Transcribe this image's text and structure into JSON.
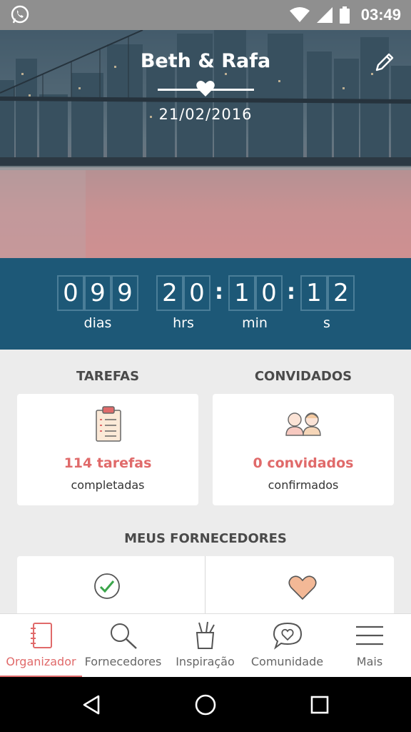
{
  "status_bar": {
    "time": "03:49"
  },
  "hero": {
    "couple": "Beth & Rafa",
    "date": "21/02/2016"
  },
  "countdown": {
    "days": [
      "0",
      "9",
      "9"
    ],
    "hours": [
      "2",
      "0"
    ],
    "minutes": [
      "1",
      "0"
    ],
    "seconds": [
      "1",
      "2"
    ],
    "units": {
      "days": "dias",
      "hours": "hrs",
      "minutes": "min",
      "seconds": "s"
    }
  },
  "tasks": {
    "title": "TAREFAS",
    "count": "114 tarefas",
    "sub": "completadas"
  },
  "guests": {
    "title": "CONVIDADOS",
    "count": "0 convidados",
    "sub": "confirmados"
  },
  "vendors": {
    "title": "MEUS FORNECEDORES"
  },
  "bottom_nav": [
    {
      "label": "Organizador",
      "icon": "notebook-icon",
      "active": true
    },
    {
      "label": "Fornecedores",
      "icon": "search-icon"
    },
    {
      "label": "Inspiração",
      "icon": "pencil-cup-icon"
    },
    {
      "label": "Comunidade",
      "icon": "chat-heart-icon"
    },
    {
      "label": "Mais",
      "icon": "menu-icon"
    }
  ],
  "colors": {
    "accent": "#e06a6a",
    "countdown_bg": "#1d5877",
    "background": "#ececec"
  }
}
